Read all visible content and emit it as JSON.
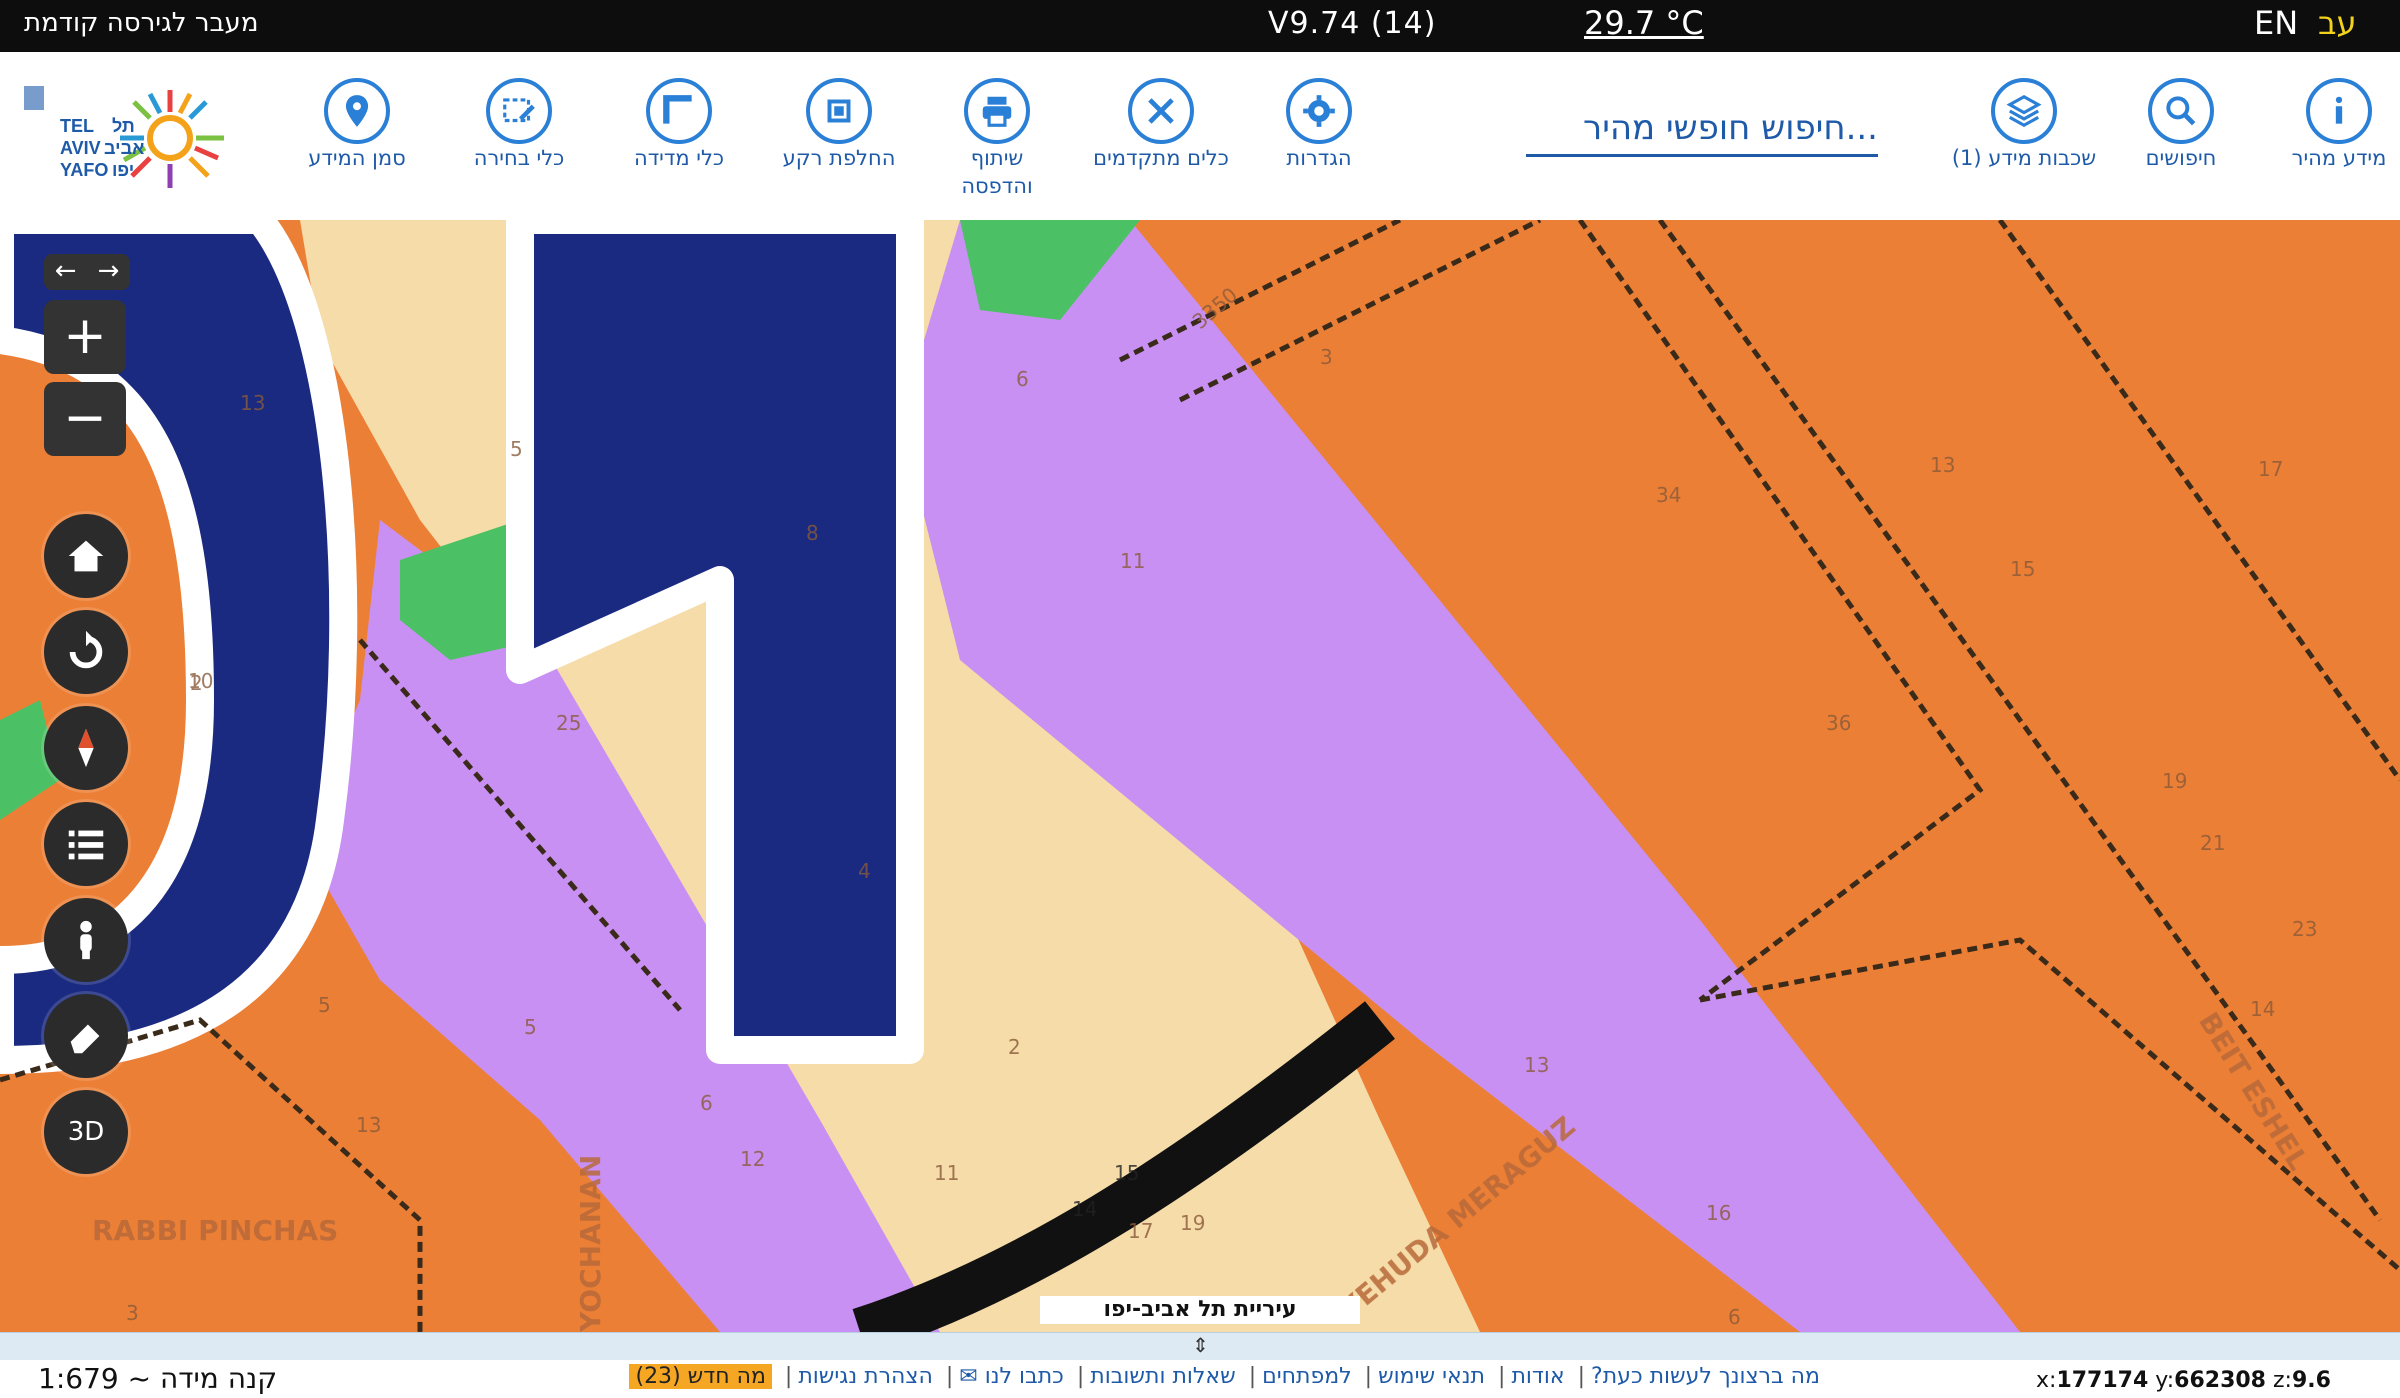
{
  "topbar": {
    "previous_version": "מעבר לגירסה קודמת",
    "version": "V9.74 (14)",
    "temperature": "29.7 °C",
    "lang_en": "EN",
    "lang_he": "עב"
  },
  "toolbar": {
    "tools": [
      {
        "label": "מידע מהיר",
        "icon": "info-icon"
      },
      {
        "label": "חיפושים",
        "icon": "search-icon"
      },
      {
        "label": "שכבות מידע (1)",
        "icon": "layers-icon"
      },
      {
        "label": "הגדרות",
        "icon": "gear-icon"
      },
      {
        "label": "כלים מתקדמים",
        "icon": "tools-icon"
      },
      {
        "label": "שיתוף והדפסה",
        "icon": "print-icon"
      },
      {
        "label": "החלפת רקע",
        "icon": "basemap-icon"
      },
      {
        "label": "כלי מדידה",
        "icon": "ruler-icon"
      },
      {
        "label": "כלי בחירה",
        "icon": "select-icon"
      },
      {
        "label": "סמן המידע",
        "icon": "marker-icon"
      }
    ],
    "search_placeholder": "חיפוש חופשי מהיר...",
    "logo_text": {
      "line1": "תל",
      "line2": "אביב",
      "line3": "יפו",
      "en1": "TEL",
      "en2": "AVIV",
      "en3": "YAFO"
    }
  },
  "map": {
    "controls": [
      "home-icon",
      "refresh-icon",
      "compass-icon",
      "legend-list-icon",
      "street-view-icon",
      "eraser-icon"
    ],
    "three_d": "3D",
    "credit": "עיריית תל אביב-יפו",
    "street_labels": [
      "RABBI PINCHAS",
      "YOCHANAN",
      "YEHUDA MERAGUZ",
      "BEIT ESHEL"
    ],
    "parcel_numbers": [
      "13",
      "5",
      "2",
      "8",
      "6",
      "3",
      "3350",
      "13",
      "34",
      "17",
      "15",
      "36",
      "19",
      "21",
      "23",
      "14",
      "25",
      "4",
      "10",
      "2",
      "12",
      "13",
      "6",
      "13",
      "11",
      "15",
      "14",
      "17",
      "19",
      "16",
      "5",
      "6",
      "11",
      "5",
      "3"
    ],
    "colors": {
      "residential": "#ec7f36",
      "road": "#c890f2",
      "open_area": "#f6dca8",
      "public_building": "#1a2a80",
      "park": "#4cc064"
    }
  },
  "bottombar": {
    "scale": "קנה מידה ~ 1:679",
    "links": [
      "מה ברצונך לעשות כעת?",
      "אודות",
      "תנאי שימוש",
      "למפתחים",
      "שאלות ותשובות",
      "כתבו לנו ✉",
      "הצהרת נגישות"
    ],
    "new_label": "מה חדש (23)",
    "coords": {
      "x_label": "x:",
      "x": "177174",
      "y_label": "y:",
      "y": "662308",
      "z_label": "z:",
      "z": "9.6"
    }
  }
}
